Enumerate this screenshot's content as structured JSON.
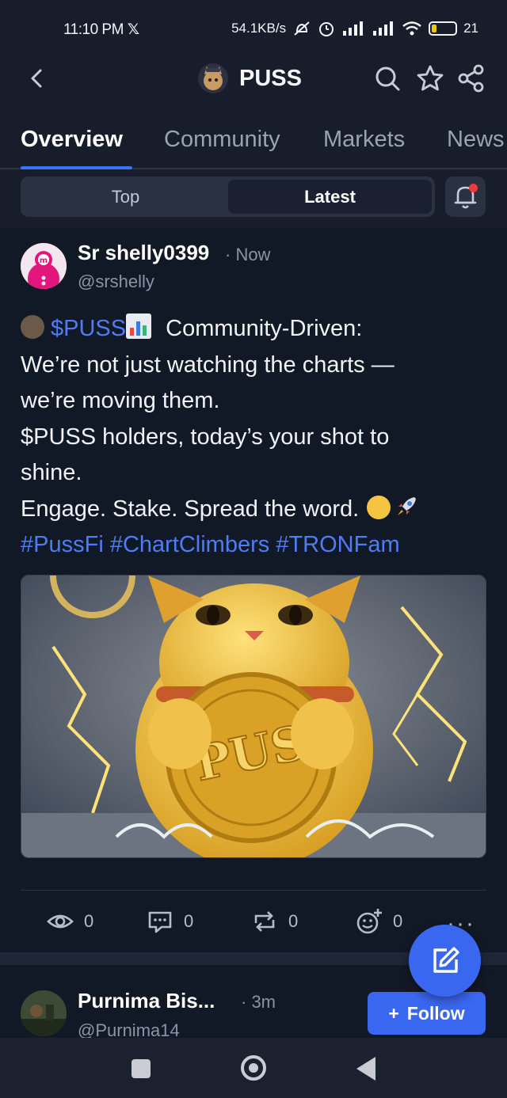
{
  "status_bar": {
    "time": "11:10 PM",
    "x_logo": "𝕏",
    "net_speed": "54.1KB/s",
    "battery": "21"
  },
  "header": {
    "title": "PUSS",
    "back_icon": "chevron-left-icon",
    "search_icon": "search-icon",
    "star_icon": "star-icon",
    "share_icon": "share-icon"
  },
  "tabs": [
    {
      "label": "Overview",
      "active": true
    },
    {
      "label": "Community",
      "active": false
    },
    {
      "label": "Markets",
      "active": false
    },
    {
      "label": "News",
      "active": false
    }
  ],
  "segment": {
    "left": "Top",
    "right": "Latest",
    "selected": "Latest"
  },
  "post": {
    "author": "Sr shelly0399",
    "time": "· Now",
    "handle": "@srshelly",
    "ticker": "$PUSS",
    "line1_rest": " Community-Driven:",
    "line2": "We’re not just watching the charts —",
    "line3": "we’re moving them.",
    "line4": "$PUSS holders, today’s your shot to",
    "line5": "shine.",
    "line6": "Engage. Stake. Spread the word.",
    "hashtags": "#PussFi #ChartClimbers #TRONFam",
    "image_text": "PUS",
    "stats": {
      "views": "0",
      "comments": "0",
      "reposts": "0",
      "reactions": "0"
    }
  },
  "next_post": {
    "author": "Purnima Bis...",
    "time": "· 3m",
    "handle": "@Purnima14",
    "follow_label": "Follow",
    "follow_plus": "+"
  },
  "colors": {
    "accent": "#3a67f0",
    "link": "#4e7cf6",
    "background": "#121926"
  }
}
